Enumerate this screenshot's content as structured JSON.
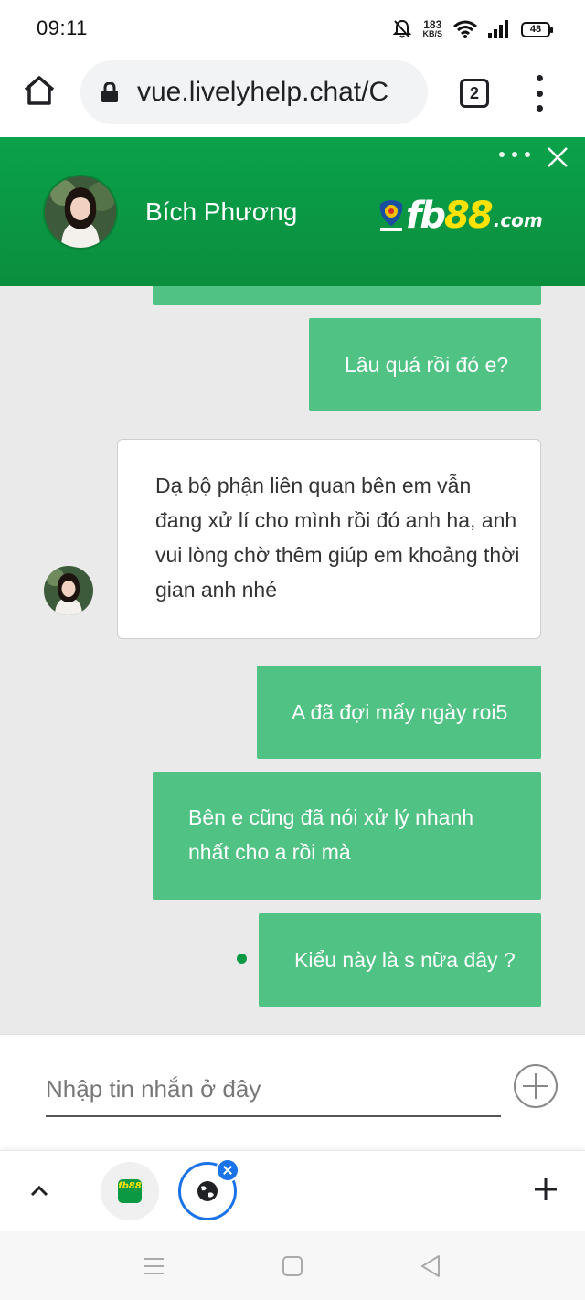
{
  "status_bar": {
    "time": "09:11",
    "net_speed": "183",
    "net_unit": "KB/S",
    "battery": "48"
  },
  "browser": {
    "url": "vue.livelyhelp.chat/C",
    "tab_count": "2"
  },
  "chat": {
    "agent_name": "Bích Phương",
    "brand_main": "fb",
    "brand_accent": "88",
    "brand_suffix": ".com",
    "brand_color": "#0aa24a",
    "messages": [
      {
        "from": "user",
        "text": "Lâu quá rồi đó e?"
      },
      {
        "from": "agent",
        "text": "Dạ bộ phận liên quan bên em vẫn đang xử lí cho mình rồi đó anh ha, anh vui lòng chờ thêm giúp em khoảng thời gian anh nhé"
      },
      {
        "from": "user",
        "text": "A đã đợi mấy ngày roi5"
      },
      {
        "from": "user",
        "text": "Bên e cũng đã nói xử lý nhanh nhất cho a rồi mà"
      },
      {
        "from": "user",
        "text": "Kiểu này là s nữa đây ?"
      }
    ],
    "input_placeholder": "Nhập tin nhắn ở đây"
  },
  "tab_switcher": {
    "fb88_tab_label": "fb88"
  }
}
